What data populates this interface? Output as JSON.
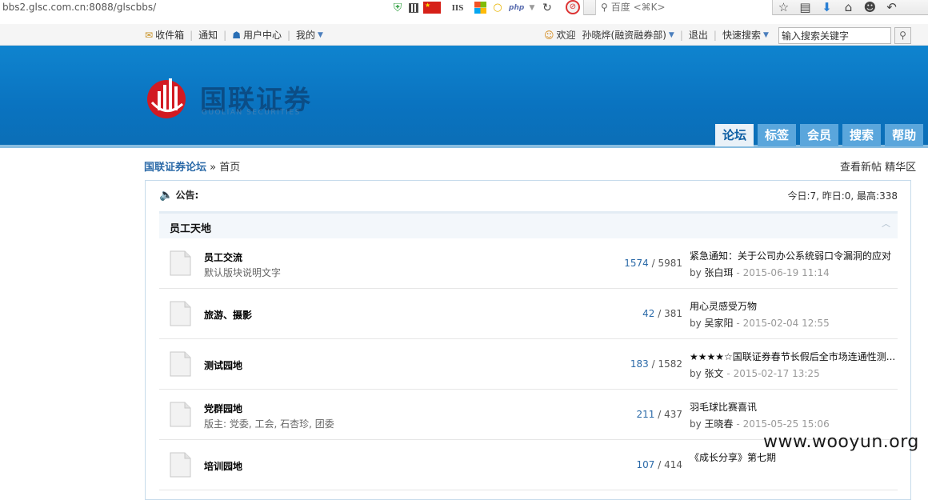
{
  "browser": {
    "url": "bbs2.glsc.com.cn:8088/glscbbs/",
    "search_placeholder": "百度 <⌘K>",
    "iis_label": "IIS",
    "php_label": "php"
  },
  "topbar": {
    "inbox": "收件箱",
    "notice": "通知",
    "user_center": "用户中心",
    "mine": "我的",
    "welcome": "欢迎",
    "username": "孙晓烨(融资融券部)",
    "logout": "退出",
    "quick_search": "快速搜索",
    "search_placeholder": "输入搜索关键字"
  },
  "header": {
    "logo_cn": "国联证券",
    "logo_en": "GUOLIAN SECURITIES",
    "nav": [
      "论坛",
      "标签",
      "会员",
      "搜索",
      "帮助"
    ],
    "active_nav": "论坛"
  },
  "breadcrumb": {
    "home": "国联证券论坛",
    "separator": "»",
    "current": "首页",
    "right_links": [
      "查看新帖",
      "精华区"
    ]
  },
  "notice": {
    "label": "公告:",
    "stats": "今日:7, 昨日:0, 最高:338"
  },
  "category": {
    "title": "员工天地"
  },
  "forums": [
    {
      "name": "员工交流",
      "desc": "默认版块说明文字",
      "topics": "1574",
      "posts": "5981",
      "last_title": "紧急通知：关于公司办公系统弱口令漏洞的应对",
      "last_author": "张白珥",
      "last_time": "2015-06-19 11:14"
    },
    {
      "name": "旅游、摄影",
      "desc": "",
      "topics": "42",
      "posts": "381",
      "last_title": "用心灵感受万物",
      "last_author": "吴家阳",
      "last_time": "2015-02-04 12:55"
    },
    {
      "name": "测试园地",
      "desc": "",
      "topics": "183",
      "posts": "1582",
      "last_title": "★★★★☆国联证券春节长假后全市场连通性测...",
      "last_author": "张文",
      "last_time": "2015-02-17 13:25"
    },
    {
      "name": "党群园地",
      "desc": "版主: 党委, 工会, 石杏珍, 团委",
      "topics": "211",
      "posts": "437",
      "last_title": "羽毛球比赛喜讯",
      "last_author": "王晓春",
      "last_time": "2015-05-25 15:06"
    },
    {
      "name": "培训园地",
      "desc": "",
      "topics": "107",
      "posts": "414",
      "last_title": "《成长分享》第七期",
      "last_author": "",
      "last_time": ""
    }
  ],
  "labels": {
    "by": "by",
    "slash": "/",
    "dash": "-"
  },
  "watermark": "www.wooyun.org"
}
